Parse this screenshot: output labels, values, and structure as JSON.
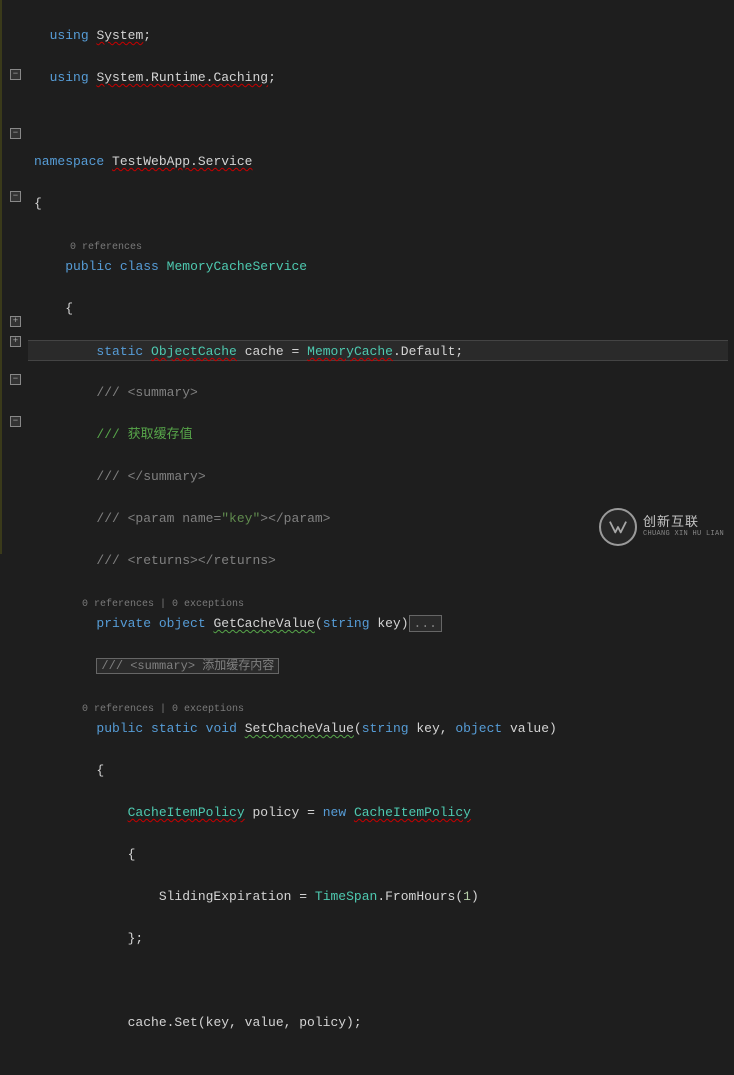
{
  "using1": {
    "kw": "using",
    "ns": "System"
  },
  "using2": {
    "kw": "using",
    "ns": "System.Runtime.Caching"
  },
  "ns": {
    "kw": "namespace",
    "name": "TestWebApp.Service"
  },
  "codelens1": "0 references",
  "class": {
    "access": "public",
    "kw": "class",
    "name": "MemoryCacheService"
  },
  "staticLine": {
    "kw": "static",
    "type": "ObjectCache",
    "name": "cache",
    "eq": "=",
    "rhsType": "MemoryCache",
    "rhsProp": ".Default;"
  },
  "summary1": {
    "open": "/// <summary>",
    "body": "/// 获取缓存值",
    "close": "/// </summary>"
  },
  "param1": {
    "open": "/// <param name=",
    "val": "\"key\"",
    "close": "></param>"
  },
  "returns1": {
    "open": "/// <returns>",
    "close": "</returns>"
  },
  "codelens2": "0 references | 0 exceptions",
  "method1": {
    "access": "private",
    "rettype": "object",
    "name": "GetCacheValue",
    "ptype": "string",
    "pname": "key"
  },
  "collapsedSummary": "/// <summary> 添加缓存内容",
  "codelens3": "0 references | 0 exceptions",
  "method2": {
    "access": "public",
    "mod": "static",
    "ret": "void",
    "name": "SetChacheValue",
    "p1type": "string",
    "p1name": "key",
    "p2type": "object",
    "p2name": "value"
  },
  "policy": {
    "type": "CacheItemPolicy",
    "name": "policy",
    "eq": "=",
    "newkw": "new",
    "ctor": "CacheItemPolicy"
  },
  "sliding": {
    "prop": "SlidingExpiration",
    "eq": "=",
    "type": "TimeSpan",
    "method": ".FromHours(",
    "num": "1",
    "close": ")"
  },
  "cacheset": "cache.Set(key, value, policy);",
  "watermark": {
    "cn": "创新互联",
    "en": "CHUANG XIN HU LIAN"
  }
}
